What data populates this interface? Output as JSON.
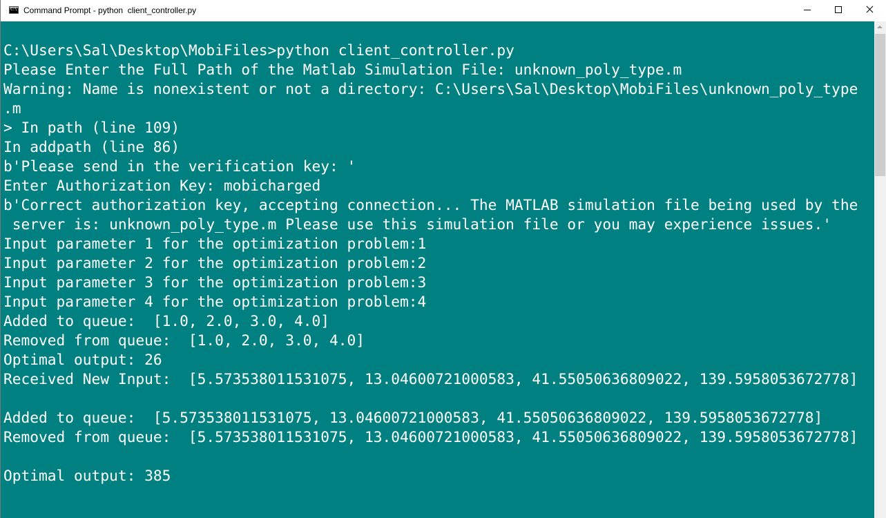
{
  "window": {
    "title": "Command Prompt - python  client_controller.py",
    "icon": "command-prompt-icon",
    "icon_text": "C:\\"
  },
  "caption_buttons": {
    "minimize_icon": "minimize-icon",
    "maximize_icon": "maximize-icon",
    "close_icon": "close-icon"
  },
  "console": {
    "background": "#008080",
    "foreground": "#ffffff",
    "lines": [
      "C:\\Users\\Sal\\Desktop\\MobiFiles>python client_controller.py",
      "Please Enter the Full Path of the Matlab Simulation File: unknown_poly_type.m",
      "Warning: Name is nonexistent or not a directory: C:\\Users\\Sal\\Desktop\\MobiFiles\\unknown_poly_type",
      ".m",
      "> In path (line 109)",
      "In addpath (line 86)",
      "b'Please send in the verification key: '",
      "Enter Authorization Key: mobicharged",
      "b'Correct authorization key, accepting connection... The MATLAB simulation file being used by the",
      " server is: unknown_poly_type.m Please use this simulation file or you may experience issues.'",
      "Input parameter 1 for the optimization problem:1",
      "Input parameter 2 for the optimization problem:2",
      "Input parameter 3 for the optimization problem:3",
      "Input parameter 4 for the optimization problem:4",
      "Added to queue:  [1.0, 2.0, 3.0, 4.0]",
      "Removed from queue:  [1.0, 2.0, 3.0, 4.0]",
      "Optimal output: 26",
      "Received New Input:  [5.573538011531075, 13.04600721000583, 41.55050636809022, 139.5958053672778]",
      "",
      "Added to queue:  [5.573538011531075, 13.04600721000583, 41.55050636809022, 139.5958053672778]",
      "Removed from queue:  [5.573538011531075, 13.04600721000583, 41.55050636809022, 139.5958053672778]",
      "",
      "Optimal output: 385"
    ]
  },
  "scrollbar": {
    "up_icon": "scroll-up-arrow-icon"
  }
}
